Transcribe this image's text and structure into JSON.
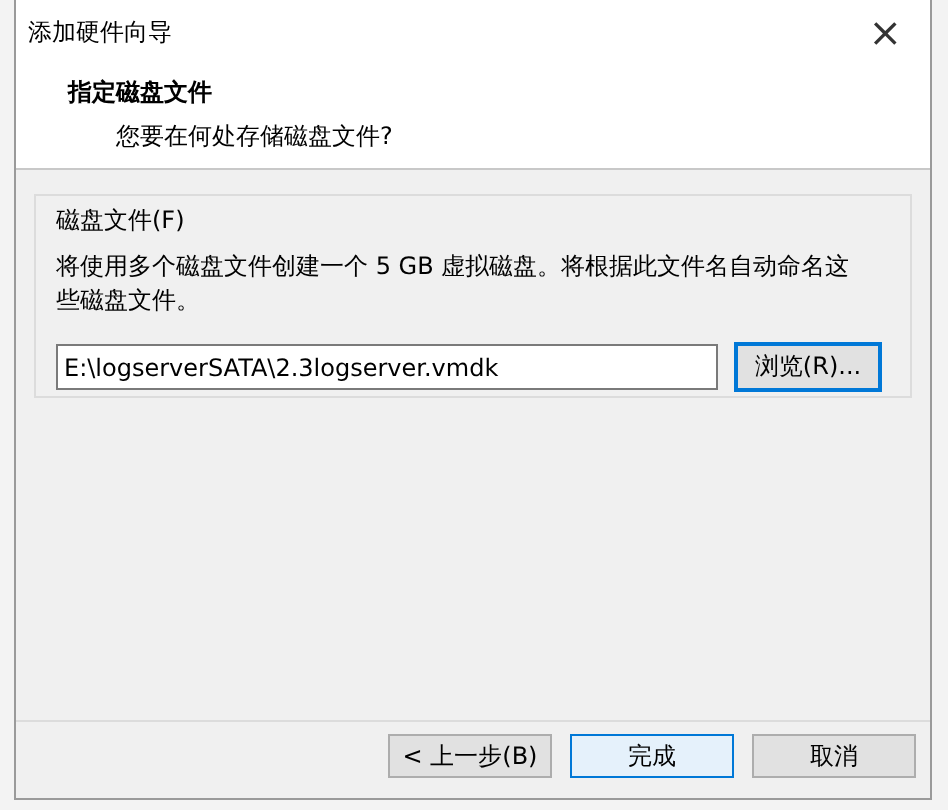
{
  "window": {
    "title": "添加硬件向导",
    "close": "×"
  },
  "header": {
    "title": "指定磁盘文件",
    "subtitle": "您要在何处存储磁盘文件?"
  },
  "group": {
    "label": "磁盘文件(F)",
    "description": "将使用多个磁盘文件创建一个 5 GB 虚拟磁盘。将根据此文件名自动命名这些磁盘文件。",
    "path": "E:\\logserverSATA\\2.3logserver.vmdk",
    "browse": "浏览(R)..."
  },
  "buttons": [
    {
      "label": "< 上一步(B)",
      "default": false
    },
    {
      "label": "完成",
      "default": true
    },
    {
      "label": "取消",
      "default": false
    }
  ]
}
